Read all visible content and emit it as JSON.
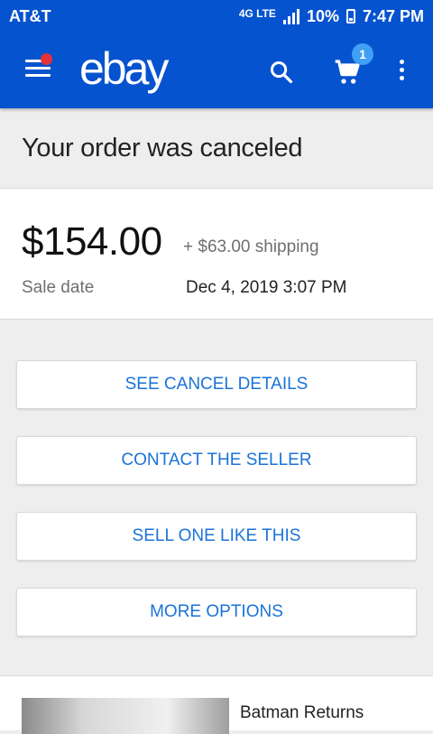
{
  "status_bar": {
    "carrier": "AT&T",
    "network": "4G LTE",
    "battery": "10%",
    "time": "7:47 PM"
  },
  "app_bar": {
    "logo": "ebay",
    "cart_count": "1"
  },
  "order": {
    "status_heading": "Your order was canceled",
    "price": "$154.00",
    "shipping": "+ $63.00 shipping",
    "sale_date_label": "Sale date",
    "sale_date_value": "Dec 4, 2019 3:07 PM"
  },
  "actions": [
    {
      "label": "SEE CANCEL DETAILS"
    },
    {
      "label": "CONTACT THE SELLER"
    },
    {
      "label": "SELL ONE LIKE THIS"
    },
    {
      "label": "MORE OPTIONS"
    }
  ],
  "item": {
    "title": "Batman Returns"
  },
  "colors": {
    "brand_blue": "#0653d0",
    "link_blue": "#1a73d9",
    "notification_red": "#e53238",
    "badge_blue": "#3fa0f5"
  }
}
